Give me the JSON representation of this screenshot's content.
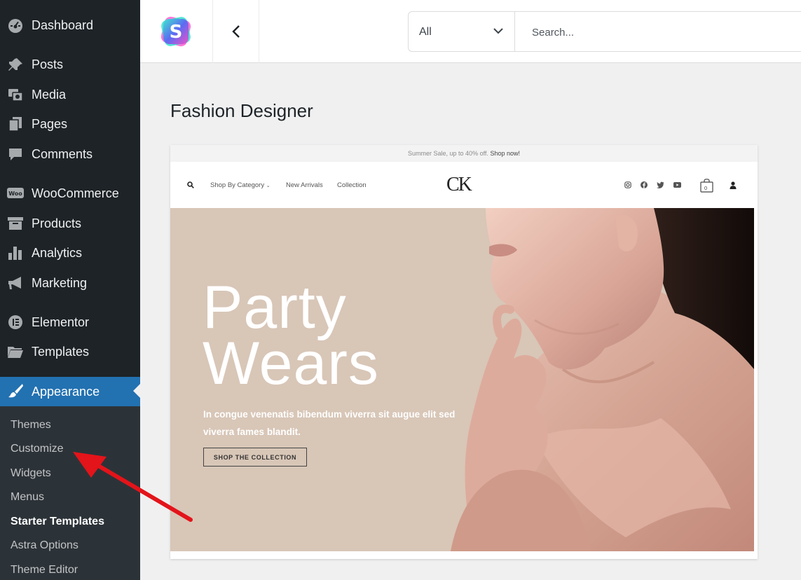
{
  "sidebar": {
    "items": [
      {
        "key": "dashboard",
        "label": "Dashboard",
        "icon": "dashboard-icon"
      },
      {
        "key": "posts",
        "label": "Posts",
        "icon": "pin-icon"
      },
      {
        "key": "media",
        "label": "Media",
        "icon": "media-icon"
      },
      {
        "key": "pages",
        "label": "Pages",
        "icon": "pages-icon"
      },
      {
        "key": "comments",
        "label": "Comments",
        "icon": "comment-icon"
      },
      {
        "key": "woocommerce",
        "label": "WooCommerce",
        "icon": "woocommerce-icon"
      },
      {
        "key": "products",
        "label": "Products",
        "icon": "archive-icon"
      },
      {
        "key": "analytics",
        "label": "Analytics",
        "icon": "bar-chart-icon"
      },
      {
        "key": "marketing",
        "label": "Marketing",
        "icon": "megaphone-icon"
      },
      {
        "key": "elementor",
        "label": "Elementor",
        "icon": "elementor-icon"
      },
      {
        "key": "templates",
        "label": "Templates",
        "icon": "folder-icon"
      },
      {
        "key": "appearance",
        "label": "Appearance",
        "icon": "paintbrush-icon"
      }
    ],
    "current": "Appearance",
    "submenu": [
      "Themes",
      "Customize",
      "Widgets",
      "Menus",
      "Starter Templates",
      "Astra Options",
      "Theme Editor"
    ],
    "submenu_active": "Starter Templates"
  },
  "topbar": {
    "logo_icon": "starter-templates-logo-icon",
    "back_icon": "chevron-left-icon",
    "type_select_value": "All",
    "search_placeholder": "Search..."
  },
  "main": {
    "title": "Fashion Designer"
  },
  "preview": {
    "announcement": "Summer Sale, up to 40% off.",
    "announcement_link": "Shop now!",
    "nav": [
      "Shop By Category",
      "New Arrivals",
      "Collection"
    ],
    "logo": "CK",
    "cart_count": "0",
    "hero_title": [
      "Party",
      "Wears"
    ],
    "hero_subtitle": "In congue venenatis bibendum viverra sit augue elit sed viverra fames blandit.",
    "hero_button": "SHOP THE COLLECTION"
  },
  "colors": {
    "sidebar_bg": "#1d2327",
    "submenu_bg": "#2c3338",
    "accent": "#2271b1",
    "hero_bg": "#d8c6b7",
    "annotation_arrow": "#e3141a"
  }
}
